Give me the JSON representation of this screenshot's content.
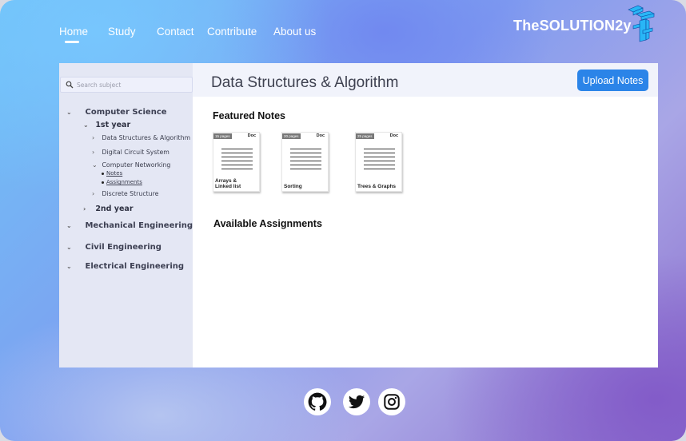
{
  "nav": {
    "items": [
      {
        "label": "Home",
        "active": true
      },
      {
        "label": "Study",
        "active": false
      },
      {
        "label": "Contact",
        "active": false
      },
      {
        "label": "Contribute",
        "active": false
      },
      {
        "label": "About us",
        "active": false
      }
    ],
    "brand": "TheSOLUTION2y"
  },
  "search": {
    "placeholder": "Search subject"
  },
  "tree": {
    "computer_science": "Computer Science",
    "first_year": "1st year",
    "dsa": "Data Structures & Algorithm",
    "dcs": "Digital Circuit System",
    "networking": "Computer Networking",
    "notes": "Notes",
    "assignments": "Assignments",
    "discrete": "Discrete Structure",
    "second_year": "2nd year",
    "mechanical": "Mechanical Engineering",
    "civil": "Civil Engineering",
    "electrical": "Electrical Engineering"
  },
  "main": {
    "title": "Data Structures & Algorithm",
    "upload_label": "Upload Notes",
    "featured_title": "Featured Notes",
    "assignments_title": "Available Assignments",
    "notes": [
      {
        "pages": "15 pages",
        "doc": "Doc",
        "title_line1": "Arrays &",
        "title_line2": "Linked list"
      },
      {
        "pages": "20 pages",
        "doc": "Doc",
        "title_line1": "Sorting",
        "title_line2": ""
      },
      {
        "pages": "25 pages",
        "doc": "Doc",
        "title_line1": "Trees & Graphs",
        "title_line2": ""
      }
    ]
  },
  "footer": {
    "icons": [
      "github-icon",
      "twitter-icon",
      "instagram-icon"
    ]
  },
  "colors": {
    "accent": "#2b84e8",
    "sidebar": "#e4e7f4"
  }
}
